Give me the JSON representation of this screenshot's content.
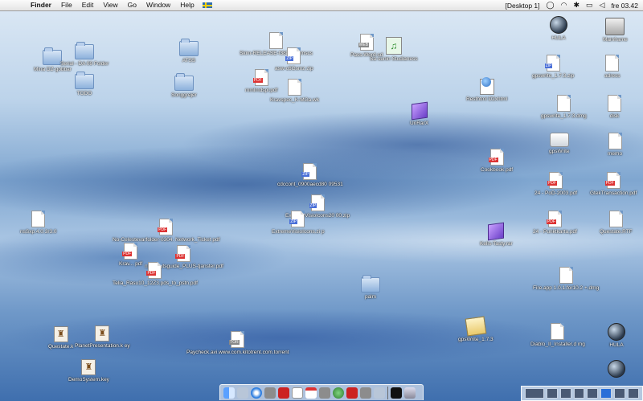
{
  "menubar": {
    "app_name": "Finder",
    "menus": [
      "File",
      "Edit",
      "View",
      "Go",
      "Window",
      "Help"
    ],
    "space": "[Desktop 1]",
    "clock": "fre 03.42",
    "flag_icon": "swedish-flag-icon"
  },
  "desktop": {
    "icons": {
      "mina_filer": "Mina DZ-gobbar",
      "serial_folder": "Serial - DA 09 Folder",
      "todo": "TODO",
      "atss": "ATSS",
      "songgrejer": "Songgrejer",
      "release": "Skim-RELEASE-f388-mmlmscs",
      "asw_zip": "asw-c6Gsmz.zip",
      "ml_pdf": "mmlmdspl.pdf",
      "kravspec": "Kravspec_K-MGa.wk",
      "pass_word": "Pass.Word.sd",
      "musik": "Sa-sunin Studianess",
      "resthtml": "Resthtml D2xhtml",
      "unrarx": "UnRarX",
      "cookbook": "Cookbook.pdf",
      "cdccont": "cdccont_0900aecd80 09531",
      "extreme_zip": "ExtremeVisioIcons20 00.zip",
      "extreme_zip2": "ExtremeVisioIcons.zi p",
      "nsxxp": "nsSxp.4.0.3r3.0",
      "no_celestevar": "No-Celestevarfolder-0304. Network_Ticket pdf",
      "krav_pdf": "Krav... pdf",
      "nyb_pdf": "nybeslutsguide_PLUS-tjanster.pdf",
      "telia": "Telia_Rasu10_12Z3.pds_to_pstn.pdf",
      "kelis": "Kelis-Tasty.rar",
      "palm": "palm",
      "questate_k": "Questate.k",
      "planet_pres": "PlanetPresentation.k ey",
      "demo_sys": "DemoSystem.key",
      "paycheck": "Paycheck.avi.www.com.kitotrent.com.torrent",
      "gpswrite_tool": "gpsWrite_1.7.3",
      "diablo": "Diablo_II_Installer.d mg",
      "fire": "Fire.app 1.0.1.for10.2 +.dmg",
      "hula_top": "HULA",
      "mainframe": "Mainframe",
      "gpswrite_pkg": "gpswrite_1.7.3.zip",
      "adress": "adress",
      "gpswrite_dmg": "gpswrite_1.7.3.dmg",
      "disk": "disk",
      "gpswrite_app": "gpsWrite",
      "memo": "memo",
      "pod": "24 - PoD-2003.pdf",
      "gtek": "GtekTransaction.pdf",
      "punkt": "24 - Punktkarta.pdf",
      "questate_rtf": "Questate.RTF",
      "hula_bottom": "HULA"
    }
  },
  "colors": {
    "menubar_bg": "#eeeeee",
    "desktop_accent": "#5c8cc6",
    "label": "#ffffff"
  }
}
